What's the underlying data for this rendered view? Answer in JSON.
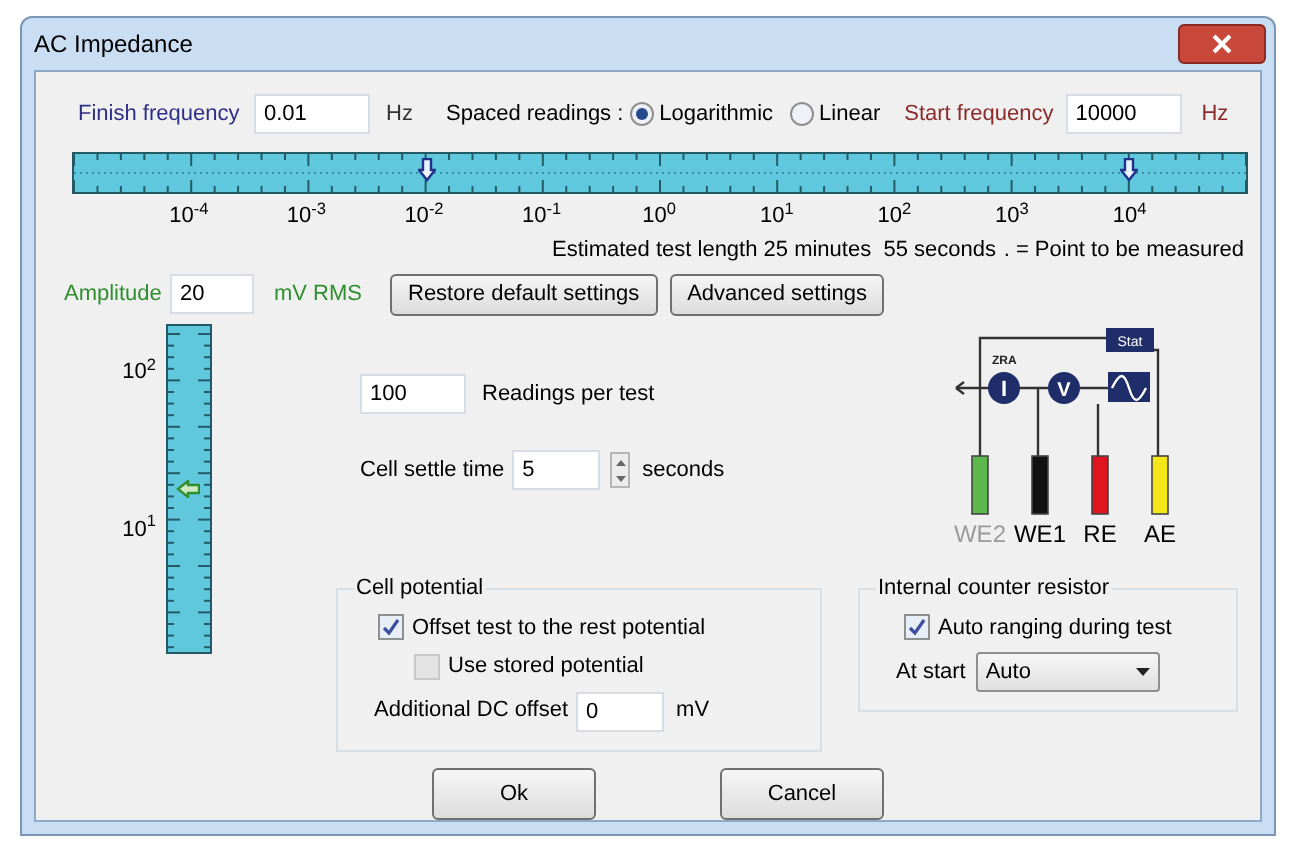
{
  "window": {
    "title": "AC Impedance"
  },
  "frequency": {
    "finish_label": "Finish frequency",
    "finish_value": "0.01",
    "finish_unit": "Hz",
    "spacing_label": "Spaced readings :",
    "start_label": "Start frequency",
    "start_value": "10000",
    "start_unit": "Hz",
    "spacing_options": [
      {
        "label": "Logarithmic",
        "selected": true
      },
      {
        "label": "Linear",
        "selected": false
      }
    ]
  },
  "frequency_scale": {
    "markers": [
      {
        "level": 0.3
      },
      {
        "level": 0.9
      }
    ],
    "tick_labels": [
      "10$^{-4}$",
      "10$^{-3}$",
      "10$^{-2}$",
      "10$^{-1}$",
      "10$^{0}$",
      "10$^{1}$",
      "10$^{2}$",
      "10$^{3}$",
      "10$^{4}$"
    ]
  },
  "estimate": "Estimated test length 25 minutes  55 seconds",
  "point_legend": ". = Point to be measured",
  "amplitude": {
    "label": "Amplitude",
    "value": "20",
    "unit": "mV RMS",
    "level": 0.5,
    "tick_labels": [
      "10$^{2}$",
      "10$^{1}$"
    ]
  },
  "settings_buttons": [
    "Restore default settings",
    "Advanced settings"
  ],
  "readings": {
    "value": "100",
    "label": "Readings per test"
  },
  "settle": {
    "label": "Cell settle time",
    "value": "5",
    "unit": "seconds"
  },
  "diagram": {
    "zra_label": "ZRA",
    "current_symbol": "I",
    "voltage_symbol": "V",
    "stat_label": "Stat",
    "electrodes": [
      {
        "label": "WE2",
        "color": "#5cb84a",
        "disabled": true
      },
      {
        "label": "WE1",
        "color": "#111111",
        "disabled": false
      },
      {
        "label": "RE",
        "color": "#e0141e",
        "disabled": false
      },
      {
        "label": "AE",
        "color": "#f5e61a",
        "disabled": false
      }
    ]
  },
  "cell_potential": {
    "title": "Cell potential",
    "dc_label": "Additional DC offset",
    "dc_value": "0",
    "dc_unit": "mV",
    "options": [
      {
        "label": "Offset test to the rest potential",
        "checked": true,
        "disabled": false
      },
      {
        "label": "Use stored potential",
        "checked": false,
        "disabled": true
      }
    ]
  },
  "counter_resistor": {
    "title": "Internal counter resistor",
    "auto_label": "Auto ranging during test",
    "auto_checked": true,
    "at_start_label": "At start",
    "at_start_value": "Auto"
  },
  "buttons": [
    "Ok",
    "Cancel"
  ]
}
